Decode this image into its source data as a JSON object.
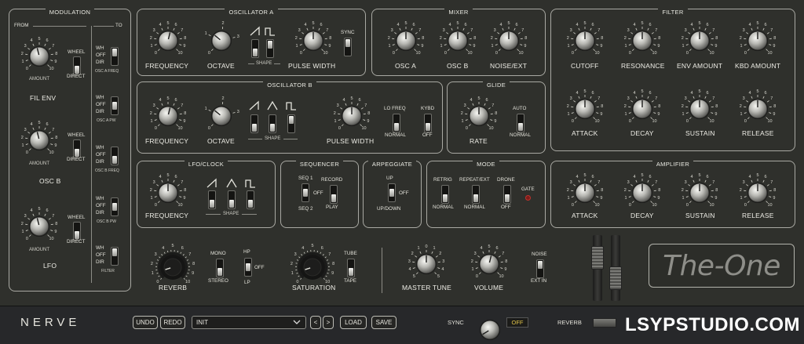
{
  "modulation": {
    "title": "MODULATION",
    "from": "FROM",
    "to": "TO",
    "sources": [
      {
        "label": "FIL ENV",
        "amount": "AMOUNT",
        "wheel": "WHEEL",
        "direct": "DIRECT"
      },
      {
        "label": "OSC B",
        "amount": "AMOUNT",
        "wheel": "WHEEL",
        "direct": "DIRECT"
      },
      {
        "label": "LFO",
        "amount": "AMOUNT",
        "wheel": "WHEEL",
        "direct": "DIRECT"
      }
    ],
    "targets": [
      {
        "label": "OSC A FREQ"
      },
      {
        "label": "OSC A PW"
      },
      {
        "label": "OSC B FREQ"
      },
      {
        "label": "OSC B PW"
      },
      {
        "label": "FILTER"
      }
    ],
    "wh": "WH",
    "off": "OFF",
    "dir": "DIR"
  },
  "oscA": {
    "title": "OSCILLATOR A",
    "frequency": "FREQUENCY",
    "octave": "OCTAVE",
    "shape": "SHAPE",
    "pulse_width": "PULSE WIDTH",
    "sync": "SYNC"
  },
  "oscB": {
    "title": "OSCILLATOR B",
    "frequency": "FREQUENCY",
    "octave": "OCTAVE",
    "shape": "SHAPE",
    "pulse_width": "PULSE WIDTH",
    "lofreq": "LO FREQ",
    "normal": "NORMAL",
    "kybd": "KYBD",
    "off": "OFF"
  },
  "mixer": {
    "title": "MIXER",
    "osca": "OSC A",
    "oscb": "OSC B",
    "noise": "NOISE/EXT"
  },
  "glide": {
    "title": "GLIDE",
    "rate": "RATE",
    "auto": "AUTO",
    "normal": "NORMAL"
  },
  "filter": {
    "title": "FILTER",
    "cutoff": "CUTOFF",
    "resonance": "RESONANCE",
    "env_amount": "ENV AMOUNT",
    "kbd_amount": "KBD AMOUNT",
    "attack": "ATTACK",
    "decay": "DECAY",
    "sustain": "SUSTAIN",
    "release": "RELEASE"
  },
  "lfo": {
    "title": "LFO/CLOCK",
    "frequency": "FREQUENCY",
    "shape": "SHAPE"
  },
  "sequencer": {
    "title": "SEQUENCER",
    "seq1": "SEQ 1",
    "seq2": "SEQ 2",
    "off": "OFF",
    "record": "RECORD",
    "play": "PLAY"
  },
  "arpeggiate": {
    "title": "ARPEGGIATE",
    "up": "UP",
    "off": "OFF",
    "updown": "UP/DOWN"
  },
  "mode": {
    "title": "MODE",
    "retrig": "RETRIG",
    "repeat": "REPEAT/EXT",
    "drone": "DRONE",
    "normal1": "NORMAL",
    "normal2": "NORMAL",
    "off": "OFF",
    "gate": "GATE"
  },
  "amplifier": {
    "title": "AMPLIFIER",
    "attack": "ATTACK",
    "decay": "DECAY",
    "sustain": "SUSTAIN",
    "release": "RELEASE"
  },
  "fx": {
    "reverb": "REVERB",
    "mono": "MONO",
    "stereo": "STEREO",
    "hp": "HP",
    "lp": "LP",
    "off": "OFF",
    "saturation": "SATURATION",
    "tube": "TUBE",
    "tape": "TAPE",
    "master_tune": "MASTER TUNE",
    "volume": "VOLUME",
    "noise": "NOISE",
    "ext_in": "EXT IN"
  },
  "logo": "The-One",
  "bottom": {
    "brand": "NERVE",
    "undo": "UNDO",
    "redo": "REDO",
    "preset": "INIT",
    "prev": "<",
    "next": ">",
    "load": "LOAD",
    "save": "SAVE",
    "sync": "SYNC",
    "sync_value": "OFF",
    "reverb": "REVERB",
    "watermark": "LSYPSTUDIO.COM"
  },
  "colors": {
    "bg": "#2f302c",
    "accent": "#e0c34a",
    "gate_led": "#c0322c"
  }
}
